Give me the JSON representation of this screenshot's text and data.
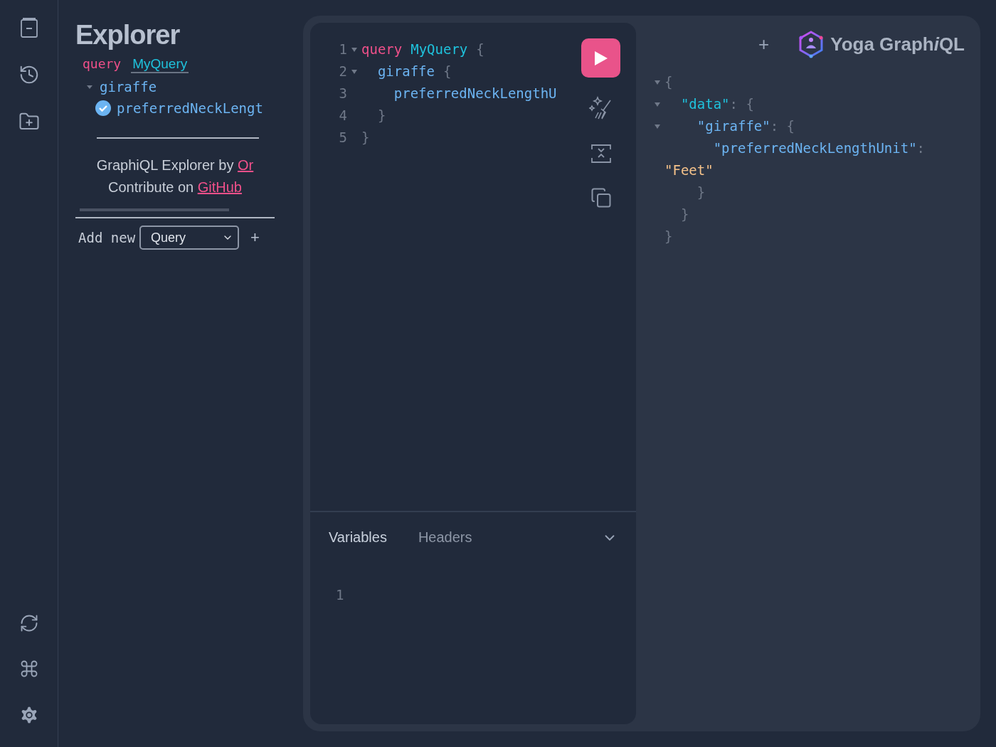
{
  "explorer": {
    "title": "Explorer",
    "operation": {
      "keyword": "query",
      "name": "MyQuery"
    },
    "fields": [
      {
        "name": "giraffe",
        "expanded": true,
        "children": [
          {
            "name": "preferredNeckLengt",
            "checked": true
          }
        ]
      }
    ],
    "credit": {
      "text": "GraphiQL Explorer by",
      "link": "Or"
    },
    "contribute": {
      "text": "Contribute on",
      "link": "GitHub"
    },
    "add_new": {
      "label": "Add new",
      "value": "Query",
      "button": "+"
    }
  },
  "editor": {
    "lines": [
      {
        "number": "1",
        "foldable": true,
        "tokens": [
          {
            "kind": "keyword",
            "text": "query"
          },
          {
            "kind": "name",
            "text": "MyQuery"
          },
          {
            "kind": "punct",
            "text": "{"
          }
        ]
      },
      {
        "number": "2",
        "foldable": true,
        "tokens": [
          {
            "kind": "field",
            "text": "  giraffe"
          },
          {
            "kind": "punct",
            "text": "{"
          }
        ]
      },
      {
        "number": "3",
        "foldable": false,
        "tokens": [
          {
            "kind": "field",
            "text": "    preferredNeckLengthU"
          }
        ]
      },
      {
        "number": "4",
        "foldable": false,
        "tokens": [
          {
            "kind": "punct",
            "text": "  }"
          }
        ]
      },
      {
        "number": "5",
        "foldable": false,
        "tokens": [
          {
            "kind": "punct",
            "text": "}"
          }
        ]
      }
    ]
  },
  "variables": {
    "tabs": [
      {
        "label": "Variables",
        "selected": true
      },
      {
        "label": "Headers",
        "selected": false
      }
    ],
    "lines": [
      "1"
    ]
  },
  "results": {
    "tab_button": "+",
    "logo": {
      "before": "Yoga Graph",
      "italic": "i",
      "after": "QL"
    },
    "lines": [
      {
        "foldable": true,
        "tokens": [
          {
            "kind": "punct",
            "text": "{"
          }
        ]
      },
      {
        "foldable": true,
        "tokens": [
          {
            "kind": "key",
            "text": "  \"data\""
          },
          {
            "kind": "punct",
            "text": ": {"
          }
        ]
      },
      {
        "foldable": true,
        "tokens": [
          {
            "kind": "fieldkey",
            "text": "    \"giraffe\""
          },
          {
            "kind": "punct",
            "text": ": {"
          }
        ]
      },
      {
        "foldable": false,
        "tokens": [
          {
            "kind": "fieldkey",
            "text": "      \"preferredNeckLengthUnit\""
          },
          {
            "kind": "punct",
            "text": ":"
          }
        ]
      },
      {
        "foldable": false,
        "tokens": [
          {
            "kind": "string",
            "text": "\"Feet\""
          }
        ]
      },
      {
        "foldable": false,
        "tokens": [
          {
            "kind": "punct",
            "text": "    }"
          }
        ]
      },
      {
        "foldable": false,
        "tokens": [
          {
            "kind": "punct",
            "text": "  }"
          }
        ]
      },
      {
        "foldable": false,
        "tokens": [
          {
            "kind": "punct",
            "text": "}"
          }
        ]
      }
    ]
  }
}
